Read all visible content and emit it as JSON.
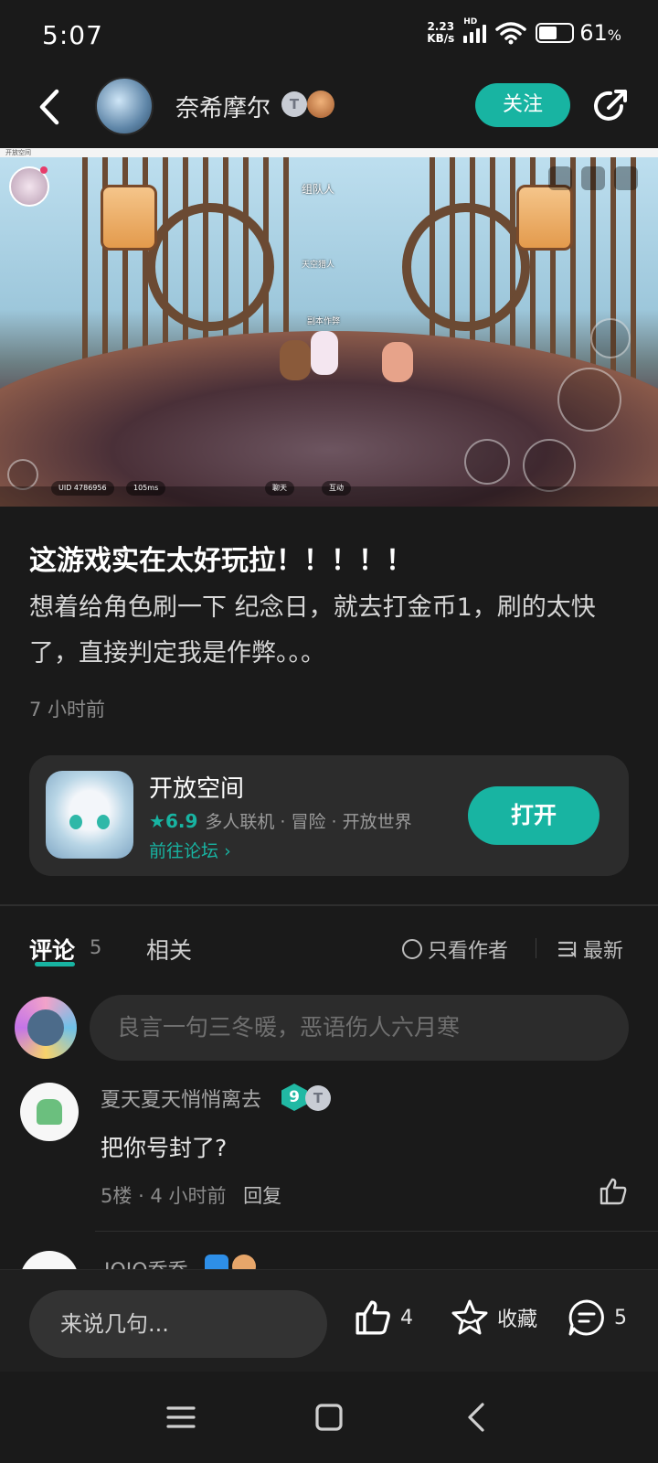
{
  "status_bar": {
    "time": "5:07",
    "net_speed_value": "2.23",
    "net_speed_unit": "KB/s",
    "network_type": "HD",
    "battery_percent": "61",
    "battery_unit": "%",
    "icons": [
      "signal-icon",
      "wifi-icon",
      "battery-icon"
    ]
  },
  "header": {
    "author_name": "奈希摩尔",
    "badge_letter": "T",
    "follow_label": "关注",
    "icons": [
      "back-icon",
      "share-icon"
    ]
  },
  "video": {
    "window_title": "开放空间",
    "uid": "UID 4786956",
    "ping": "105ms",
    "chat_label": "聊天",
    "interact_label": "互动",
    "center_label": "副本作弊",
    "npc_label": "天空猎人",
    "top_banner": "组队人"
  },
  "post": {
    "title": "这游戏实在太好玩拉！！！！！",
    "body": "想着给角色刷一下 纪念日，就去打金币1，刷的太快了，直接判定我是作弊。。。",
    "time": "7 小时前"
  },
  "app_card": {
    "name": "开放空间",
    "rating": "6.9",
    "tags": "多人联机 · 冒险 · 开放世界",
    "forum_link": "前往论坛",
    "open_label": "打开",
    "accent": "#18b4a2"
  },
  "tabs": {
    "comments_label": "评论",
    "comments_count": "5",
    "related_label": "相关",
    "only_author_label": "只看作者",
    "sort_label": "最新"
  },
  "comment_input": {
    "placeholder": "良言一句三冬暖，恶语伤人六月寒"
  },
  "comments": [
    {
      "user": "夏天夏天悄悄离去",
      "level": "9",
      "badge_letter": "T",
      "text": "把你号封了?",
      "floor": "5楼",
      "time": "4 小时前",
      "reply_label": "回复"
    },
    {
      "user": "JOJO乔乔"
    }
  ],
  "bottom_bar": {
    "placeholder": "来说几句...",
    "like_count": "4",
    "favorite_label": "收藏",
    "comment_count": "5"
  }
}
